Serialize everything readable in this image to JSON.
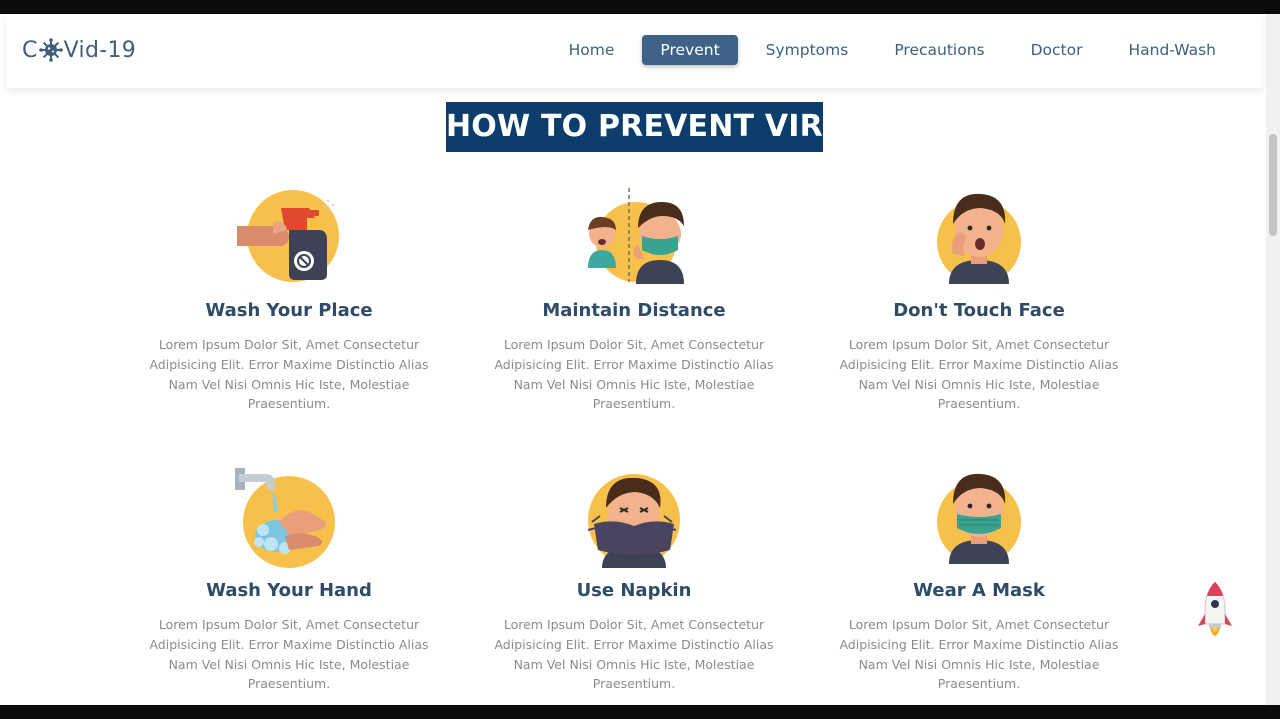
{
  "header": {
    "logo_prefix": "C",
    "logo_suffix": "Vid-19",
    "nav": [
      {
        "label": "Home",
        "active": false
      },
      {
        "label": "Prevent",
        "active": true
      },
      {
        "label": "Symptoms",
        "active": false
      },
      {
        "label": "Precautions",
        "active": false
      },
      {
        "label": "Doctor",
        "active": false
      },
      {
        "label": "Hand-Wash",
        "active": false
      }
    ]
  },
  "section": {
    "heading": "HOW TO PREVENT VIRUS",
    "cards": [
      {
        "title": "Wash Your Place",
        "icon": "spray-bottle-icon",
        "desc": "Lorem Ipsum Dolor Sit, Amet Consectetur Adipisicing Elit. Error Maxime Distinctio Alias Nam Vel Nisi Omnis Hic Iste, Molestiae Praesentium."
      },
      {
        "title": "Maintain Distance",
        "icon": "distance-icon",
        "desc": "Lorem Ipsum Dolor Sit, Amet Consectetur Adipisicing Elit. Error Maxime Distinctio Alias Nam Vel Nisi Omnis Hic Iste, Molestiae Praesentium."
      },
      {
        "title": "Don't Touch Face",
        "icon": "touch-face-icon",
        "desc": "Lorem Ipsum Dolor Sit, Amet Consectetur Adipisicing Elit. Error Maxime Distinctio Alias Nam Vel Nisi Omnis Hic Iste, Molestiae Praesentium."
      },
      {
        "title": "Wash Your Hand",
        "icon": "hand-wash-icon",
        "desc": "Lorem Ipsum Dolor Sit, Amet Consectetur Adipisicing Elit. Error Maxime Distinctio Alias Nam Vel Nisi Omnis Hic Iste, Molestiae Praesentium."
      },
      {
        "title": "Use Napkin",
        "icon": "napkin-icon",
        "desc": "Lorem Ipsum Dolor Sit, Amet Consectetur Adipisicing Elit. Error Maxime Distinctio Alias Nam Vel Nisi Omnis Hic Iste, Molestiae Praesentium."
      },
      {
        "title": "Wear A Mask",
        "icon": "mask-icon",
        "desc": "Lorem Ipsum Dolor Sit, Amet Consectetur Adipisicing Elit. Error Maxime Distinctio Alias Nam Vel Nisi Omnis Hic Iste, Molestiae Praesentium."
      }
    ]
  },
  "colors": {
    "accent": "#3f6386",
    "heading_bg": "#0c3d6b",
    "title": "#2f4b66",
    "illustration_circle": "#f6c04b",
    "body_text": "#8b8b8b"
  }
}
